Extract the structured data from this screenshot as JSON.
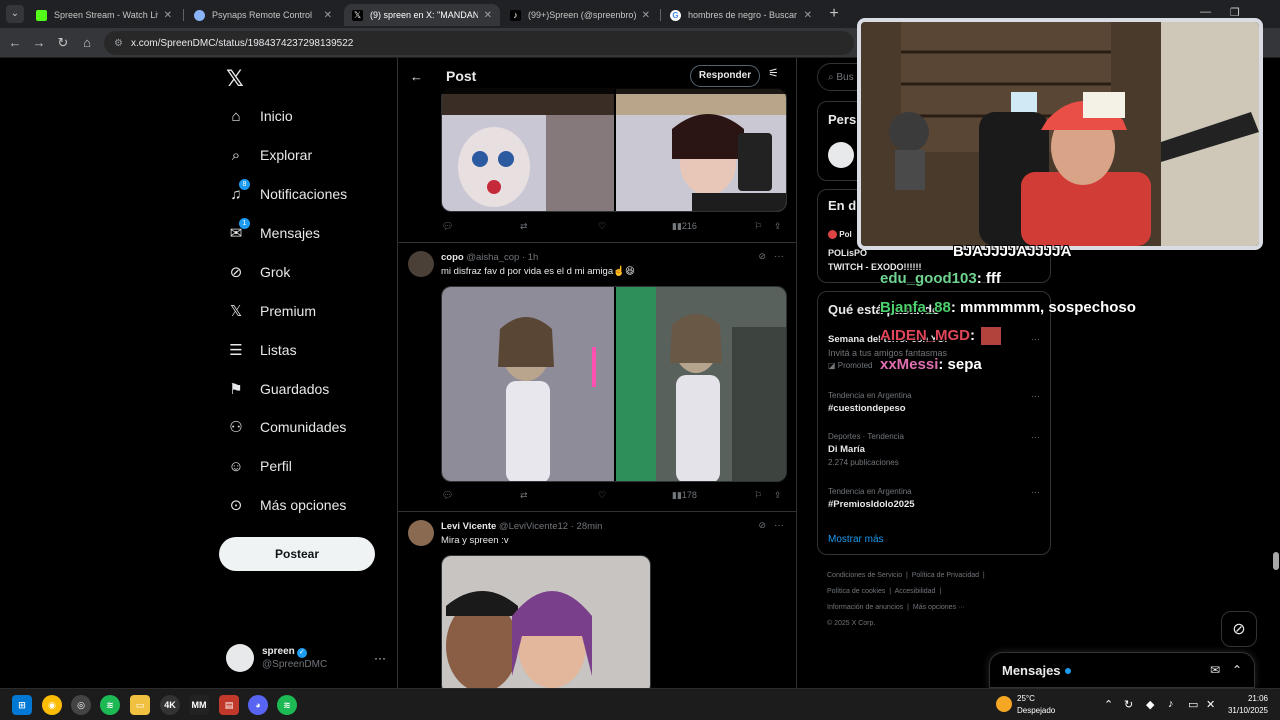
{
  "browser": {
    "tabs": [
      {
        "title": "Spreen Stream - Watch Live on",
        "color": "#53fc18"
      },
      {
        "title": "Psynaps Remote Control",
        "color": "#8ab4f8"
      },
      {
        "title": "(9) spreen en X: \"MANDANME",
        "color": "#000000"
      },
      {
        "title": "(99+)Spreen (@spreenbro) ofic",
        "color": "#000000"
      },
      {
        "title": "hombres de negro - Buscar con",
        "color": "#4285f4"
      }
    ],
    "url": "x.com/SpreenDMC/status/1984374237298139522"
  },
  "nav": {
    "items": [
      {
        "label": "Inicio",
        "icon": "home-icon",
        "glyph": "⌂"
      },
      {
        "label": "Explorar",
        "icon": "search-icon",
        "glyph": "⌕"
      },
      {
        "label": "Notificaciones",
        "icon": "bell-icon",
        "glyph": "🔔",
        "badge": "8"
      },
      {
        "label": "Mensajes",
        "icon": "mail-icon",
        "glyph": "✉",
        "badge": "1"
      },
      {
        "label": "Grok",
        "icon": "grok-icon",
        "glyph": "⊘"
      },
      {
        "label": "Premium",
        "icon": "x-premium-icon",
        "glyph": "𝕏"
      },
      {
        "label": "Listas",
        "icon": "list-icon",
        "glyph": "☰"
      },
      {
        "label": "Guardados",
        "icon": "bookmark-icon",
        "glyph": "🔖"
      },
      {
        "label": "Comunidades",
        "icon": "communities-icon",
        "glyph": "👥"
      },
      {
        "label": "Perfil",
        "icon": "profile-icon",
        "glyph": "👤"
      },
      {
        "label": "Más opciones",
        "icon": "more-options-icon",
        "glyph": "⋯"
      }
    ],
    "post_button": "Postear",
    "account": {
      "name": "spreen",
      "handle": "@SpreenDMC"
    }
  },
  "timeline": {
    "title": "Post",
    "reply_button": "Responder",
    "posts": [
      {
        "views": "216"
      },
      {
        "name": "copo",
        "handle": "@aisha_cop",
        "time": "1h",
        "text": "mi disfraz fav d por vida es el d mi amiga☝️😆",
        "views": "178"
      },
      {
        "name": "Levi Vicente",
        "handle": "@LeviVicente12",
        "time": "28min",
        "text": "Mira y spreen :v"
      }
    ]
  },
  "sidebar": {
    "search_placeholder": "Bus",
    "box1_title": "Pers",
    "box2_title": "En d",
    "box2_snippet": "Pol",
    "live_text": "POLisPO",
    "live_text2": "TWITCH - EXODO!!!!!!",
    "trends_title": "Qué está pasando",
    "promo": {
      "title": "Semana del terror con YOI",
      "desc": "Invitá a tus amigos fantasmas",
      "label": "Promoted"
    },
    "trends": [
      {
        "cat": "Tendencia en Argentina",
        "title": "#cuestiondepeso",
        "count": ""
      },
      {
        "cat": "Deportes · Tendencia",
        "title": "Di María",
        "count": "2.274 publicaciones"
      },
      {
        "cat": "Tendencia en Argentina",
        "title": "#PremiosIdolo2025",
        "count": ""
      }
    ],
    "show_more": "Mostrar más",
    "footer": [
      "Condiciones de Servicio",
      "Política de Privacidad",
      "Política de cookies",
      "Accesibilidad",
      "Información de anuncios",
      "Más opciones ···",
      "© 2025 X Corp."
    ]
  },
  "messages_dock": {
    "title": "Mensajes"
  },
  "overlay_chat": [
    {
      "user": "",
      "msg": "BJAJJJJAJJJJA",
      "color": "#ffffff"
    },
    {
      "user": "edu_good103",
      "msg": ": fff",
      "color": "#6fd38f"
    },
    {
      "user": "Bjanfa_88",
      "msg": ": mmmmmm, sospechoso",
      "color": "#4cd06e"
    },
    {
      "user": "AIDEN_MGD",
      "msg": ":",
      "color": "#e0455a"
    },
    {
      "user": "xxMessi",
      "msg": ": sepa",
      "color": "#e06fb0"
    }
  ],
  "taskbar": {
    "weather_temp": "25°C",
    "weather_desc": "Despejado",
    "time": "21:06",
    "date": "31/10/2025"
  }
}
